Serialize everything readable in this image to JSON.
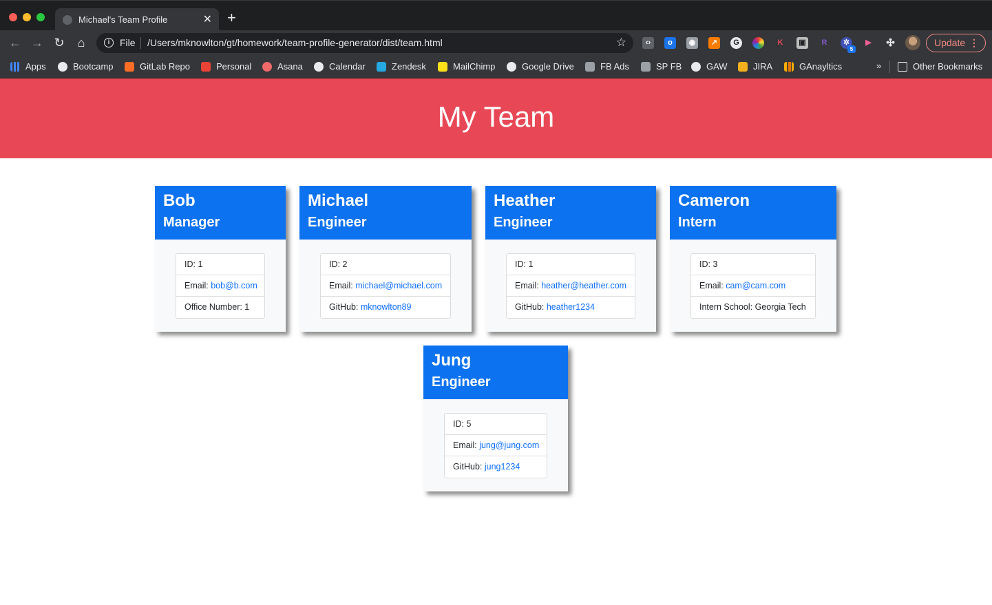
{
  "browser": {
    "tab_title": "Michael's Team Profile",
    "url_scheme": "File",
    "url": "/Users/mknowlton/gt/homework/team-profile-generator/dist/team.html",
    "update_label": "Update",
    "bookmarks": [
      "Apps",
      "Bootcamp",
      "GitLab Repo",
      "Personal",
      "Asana",
      "Calendar",
      "Zendesk",
      "MailChimp",
      "Google Drive",
      "FB Ads",
      "SP FB",
      "GAW",
      "JIRA",
      "GAnayltics"
    ],
    "more_bookmarks": "»",
    "other_bookmarks": "Other Bookmarks",
    "extension_badge": "5"
  },
  "page": {
    "title": "My Team",
    "colors": {
      "header": "#e84855",
      "card_header": "#0d72ef"
    }
  },
  "team": [
    {
      "name": "Bob",
      "role": "Manager",
      "id": "ID: 1",
      "email_label": "Email: ",
      "email": "bob@b.com",
      "third_label": "Office Number: 1",
      "third_link": ""
    },
    {
      "name": "Michael",
      "role": "Engineer",
      "id": "ID: 2",
      "email_label": "Email: ",
      "email": "michael@michael.com",
      "third_label": "GitHub: ",
      "third_link": "mknowlton89"
    },
    {
      "name": "Heather",
      "role": "Engineer",
      "id": "ID: 1",
      "email_label": "Email: ",
      "email": "heather@heather.com",
      "third_label": "GitHub: ",
      "third_link": "heather1234"
    },
    {
      "name": "Cameron",
      "role": "Intern",
      "id": "ID: 3",
      "email_label": "Email: ",
      "email": "cam@cam.com",
      "third_label": "Intern School: Georgia Tech",
      "third_link": ""
    },
    {
      "name": "Jung",
      "role": "Engineer",
      "id": "ID: 5",
      "email_label": "Email: ",
      "email": "jung@jung.com",
      "third_label": "GitHub: ",
      "third_link": "jung1234"
    }
  ]
}
